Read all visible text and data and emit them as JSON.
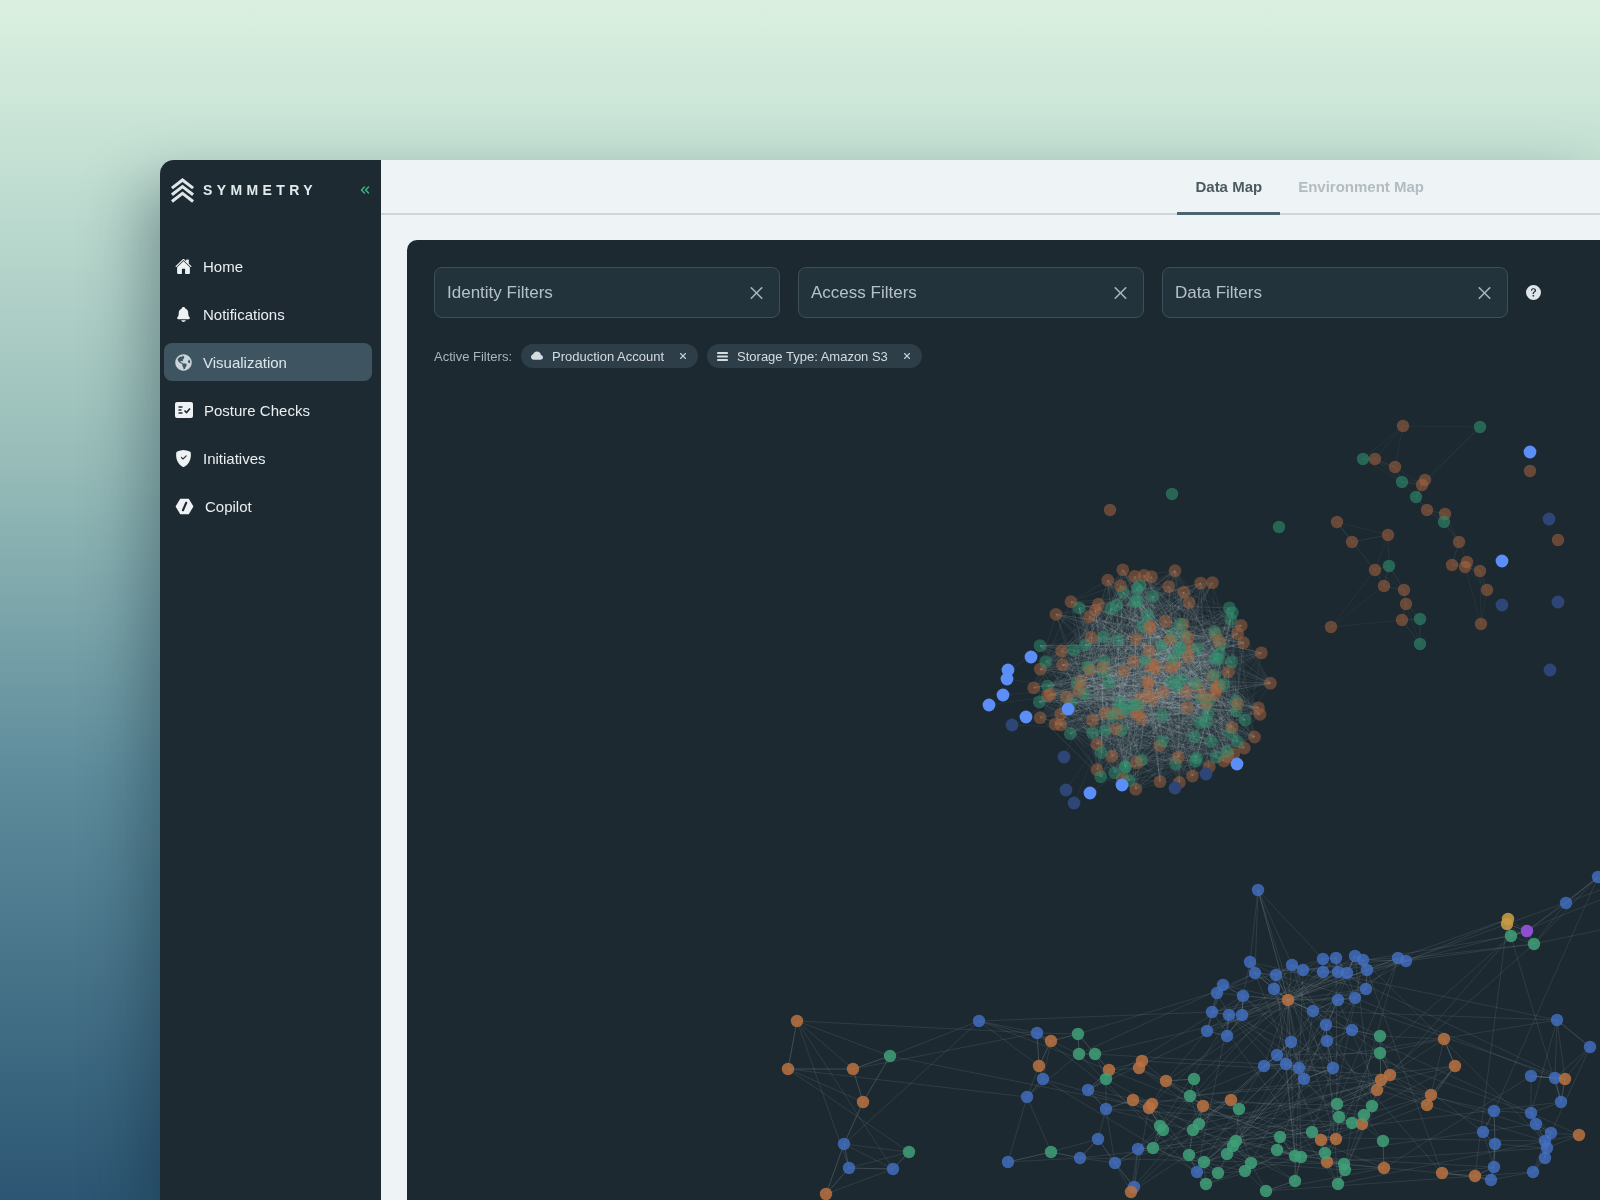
{
  "sidebar": {
    "brand": "SYMMETRY",
    "items": [
      {
        "label": "Home",
        "selected": false
      },
      {
        "label": "Notifications",
        "selected": false
      },
      {
        "label": "Visualization",
        "selected": true
      },
      {
        "label": "Posture Checks",
        "selected": false
      },
      {
        "label": "Initiatives",
        "selected": false
      },
      {
        "label": "Copilot",
        "selected": false
      }
    ]
  },
  "tabs": [
    {
      "label": "Data Map",
      "selected": true
    },
    {
      "label": "Environment Map",
      "selected": false
    }
  ],
  "filters": [
    {
      "placeholder": "Identity Filters"
    },
    {
      "placeholder": "Access Filters"
    },
    {
      "placeholder": "Data Filters"
    }
  ],
  "active_filters": {
    "label": "Active Filters:",
    "chips": [
      {
        "label": "Production Account"
      },
      {
        "label": "Storage Type: Amazon S3"
      }
    ]
  }
}
